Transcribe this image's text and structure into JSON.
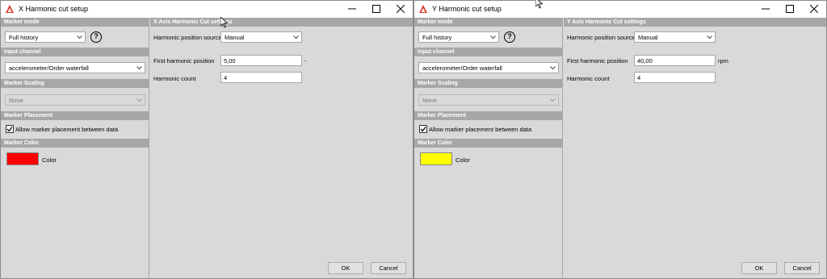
{
  "windows": [
    {
      "title": "X Harmonic cut setup",
      "sections": {
        "marker_mode": "Marker mode",
        "input_channel": "Input channel",
        "marker_scaling": "Marker Scaling",
        "marker_placement": "Marker Placement",
        "marker_color": "Marker Color"
      },
      "marker_mode_value": "Full history",
      "help_glyph": "?",
      "input_channel_value": "accelerometer/Order waterfall",
      "marker_scaling_value": "None",
      "allow_placement_label": "Allow marker placement between data",
      "allow_placement_checked": true,
      "color_label": "Color",
      "color_value": "#ff0000",
      "settings_title": "X Axis Harmonic Cut settings",
      "harmonic_source_label": "Harmonic position source",
      "harmonic_source_value": "Manual",
      "first_position_label": "First harmonic position",
      "first_position_value": "5,00",
      "first_position_unit": "-",
      "harmonic_count_label": "Harmonic count",
      "harmonic_count_value": "4",
      "ok_label": "OK",
      "cancel_label": "Cancel"
    },
    {
      "title": "Y Harmonic cut setup",
      "sections": {
        "marker_mode": "Marker mode",
        "input_channel": "Input channel",
        "marker_scaling": "Marker Scaling",
        "marker_placement": "Marker Placement",
        "marker_color": "Marker Color"
      },
      "marker_mode_value": "Full history",
      "help_glyph": "?",
      "input_channel_value": "accelerometer/Order waterfall",
      "marker_scaling_value": "None",
      "allow_placement_label": "Allow marker placement between data",
      "allow_placement_checked": true,
      "color_label": "Color",
      "color_value": "#ffff00",
      "settings_title": "Y Axis Harmonic Cut settings",
      "harmonic_source_label": "Harmonic position source",
      "harmonic_source_value": "Manual",
      "first_position_label": "First harmonic position",
      "first_position_value": "40,00",
      "first_position_unit": "rpm",
      "harmonic_count_label": "Harmonic count",
      "harmonic_count_value": "4",
      "ok_label": "OK",
      "cancel_label": "Cancel"
    }
  ],
  "icons": [
    "app-logo-icon",
    "minimize-icon",
    "maximize-icon",
    "close-icon",
    "chevron-down-icon",
    "help-icon",
    "checkmark-icon",
    "mouse-cursor-icon"
  ]
}
